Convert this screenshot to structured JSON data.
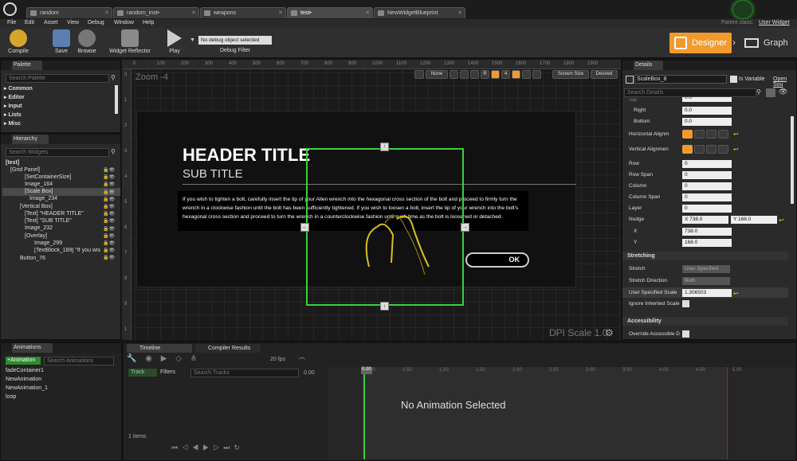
{
  "tabs": [
    {
      "label": "random"
    },
    {
      "label": "random_inst•"
    },
    {
      "label": "weapons"
    },
    {
      "label": "test•"
    },
    {
      "label": "NewWidgetBlueprint"
    }
  ],
  "parent_class": {
    "label": "Parent class:",
    "value": "User Widget"
  },
  "menu": [
    "File",
    "Edit",
    "Asset",
    "View",
    "Debug",
    "Window",
    "Help"
  ],
  "toolbar": {
    "compile": "Compile",
    "save": "Save",
    "browse": "Browse",
    "reflector": "Widget Reflector",
    "play": "Play",
    "debug_object": "No debug object selected",
    "debug_filter": "Debug Filter",
    "designer": "Designer",
    "graph": "Graph"
  },
  "palette": {
    "title": "Palette",
    "search_placeholder": "Search Palette",
    "categories": [
      "Common",
      "Editor",
      "Input",
      "Lists",
      "Misc"
    ]
  },
  "hierarchy": {
    "title": "Hierarchy",
    "search_placeholder": "Search Widgets",
    "items": [
      "[test]",
      "[Grid Panel]",
      "[SetContainerSize]",
      "Image_164",
      "[Scale Box]",
      "Image_234",
      "[Vertical Box]",
      "[Text] \"HEADER TITLE\"",
      "[Text] \"SUB TITLE\"",
      "Image_232",
      "[Overlay]",
      "Image_299",
      "[TextBlock_189] \"If you wis",
      "Button_76"
    ]
  },
  "viewport": {
    "zoom": "Zoom -4",
    "none": "None",
    "r_label": "R",
    "snap_value": "4",
    "screen_size": "Screen Size",
    "desired": "Desired",
    "ruler_top": [
      "0",
      "100",
      "200",
      "300",
      "400",
      "500",
      "600",
      "700",
      "800",
      "900",
      "1000",
      "1100",
      "1200",
      "1300",
      "1400",
      "1500",
      "1600",
      "1700",
      "1800",
      "1900"
    ],
    "ruler_left": [
      "0",
      "1",
      "2",
      "3",
      "4",
      "5",
      "6",
      "7",
      "8",
      "9",
      "1"
    ],
    "dpi": "DPI Scale 1.0",
    "header_title": "HEADER TITLE",
    "sub_title": "SUB TITLE",
    "body_text": "If you wish to tighten a bolt, carefully insert the tip of your Allen wrench into the hexagonal cross section of the bolt and proceed to firmly turn the wrench in a clockwise fashion until the bolt has been sufficiently tightened. If you wish to loosen a bolt, insert the tip of your wrench into the bolt's hexagonal cross section and proceed to turn the wrench in a counterclockwise fashion until such time as the bolt is loosened or detached.",
    "ok": "OK"
  },
  "details": {
    "title": "Details",
    "name": "ScaleBox_8",
    "is_variable": "Is Variable",
    "open_source": "Open Sou",
    "search_placeholder": "Search Details",
    "top_label": "Top",
    "right_label": "Right",
    "right_value": "0.0",
    "bottom_label": "Bottom",
    "bottom_value": "0.0",
    "top_value": "0.0",
    "h_align": "Horizontal Alignm",
    "v_align": "Vertical Alignmen",
    "row": "Row",
    "row_value": "0",
    "row_span": "Row Span",
    "row_span_value": "0",
    "column": "Column",
    "column_value": "0",
    "column_span": "Column Span",
    "column_span_value": "0",
    "layer": "Layer",
    "layer_value": "0",
    "nudge": "Nudge",
    "nudge_x": "X  738.0",
    "nudge_y": "Y  168.0",
    "x_label": "X",
    "x_value": "738.0",
    "y_label": "Y",
    "y_value": "168.0",
    "stretching": "Stretching",
    "stretch": "Stretch",
    "stretch_value": "User Specified",
    "stretch_dir": "Stretch Direction",
    "stretch_dir_value": "Both",
    "user_scale": "User Specified Scale",
    "user_scale_value": "1.306503",
    "ignore_scale": "Ignore Inherited Scale",
    "accessibility": "Accessibility",
    "override_access": "Override Accessible D"
  },
  "animations": {
    "title": "Animations",
    "add": "+Animation",
    "search_placeholder": "Search Animations",
    "items": [
      "fadeContainer1",
      "NewAnimation",
      "NewAnimation_1",
      "loop"
    ]
  },
  "timeline": {
    "tab1": "Timeline",
    "tab2": "Compiler Results",
    "track": "Track",
    "filters": "Filters",
    "search_placeholder": "Search Tracks",
    "fps": "20 fps",
    "time": "0.00",
    "playhead": "0.00",
    "items_count": "1 items",
    "empty": "No Animation Selected",
    "ticks": [
      "0.00",
      "0.50",
      "1.00",
      "1.50",
      "2.00",
      "2.50",
      "3.00",
      "3.50",
      "4.00",
      "4.50",
      "5.00"
    ]
  },
  "colors": {
    "accent": "#f29a2e",
    "selection": "#38d13a",
    "bg": "#151515"
  }
}
